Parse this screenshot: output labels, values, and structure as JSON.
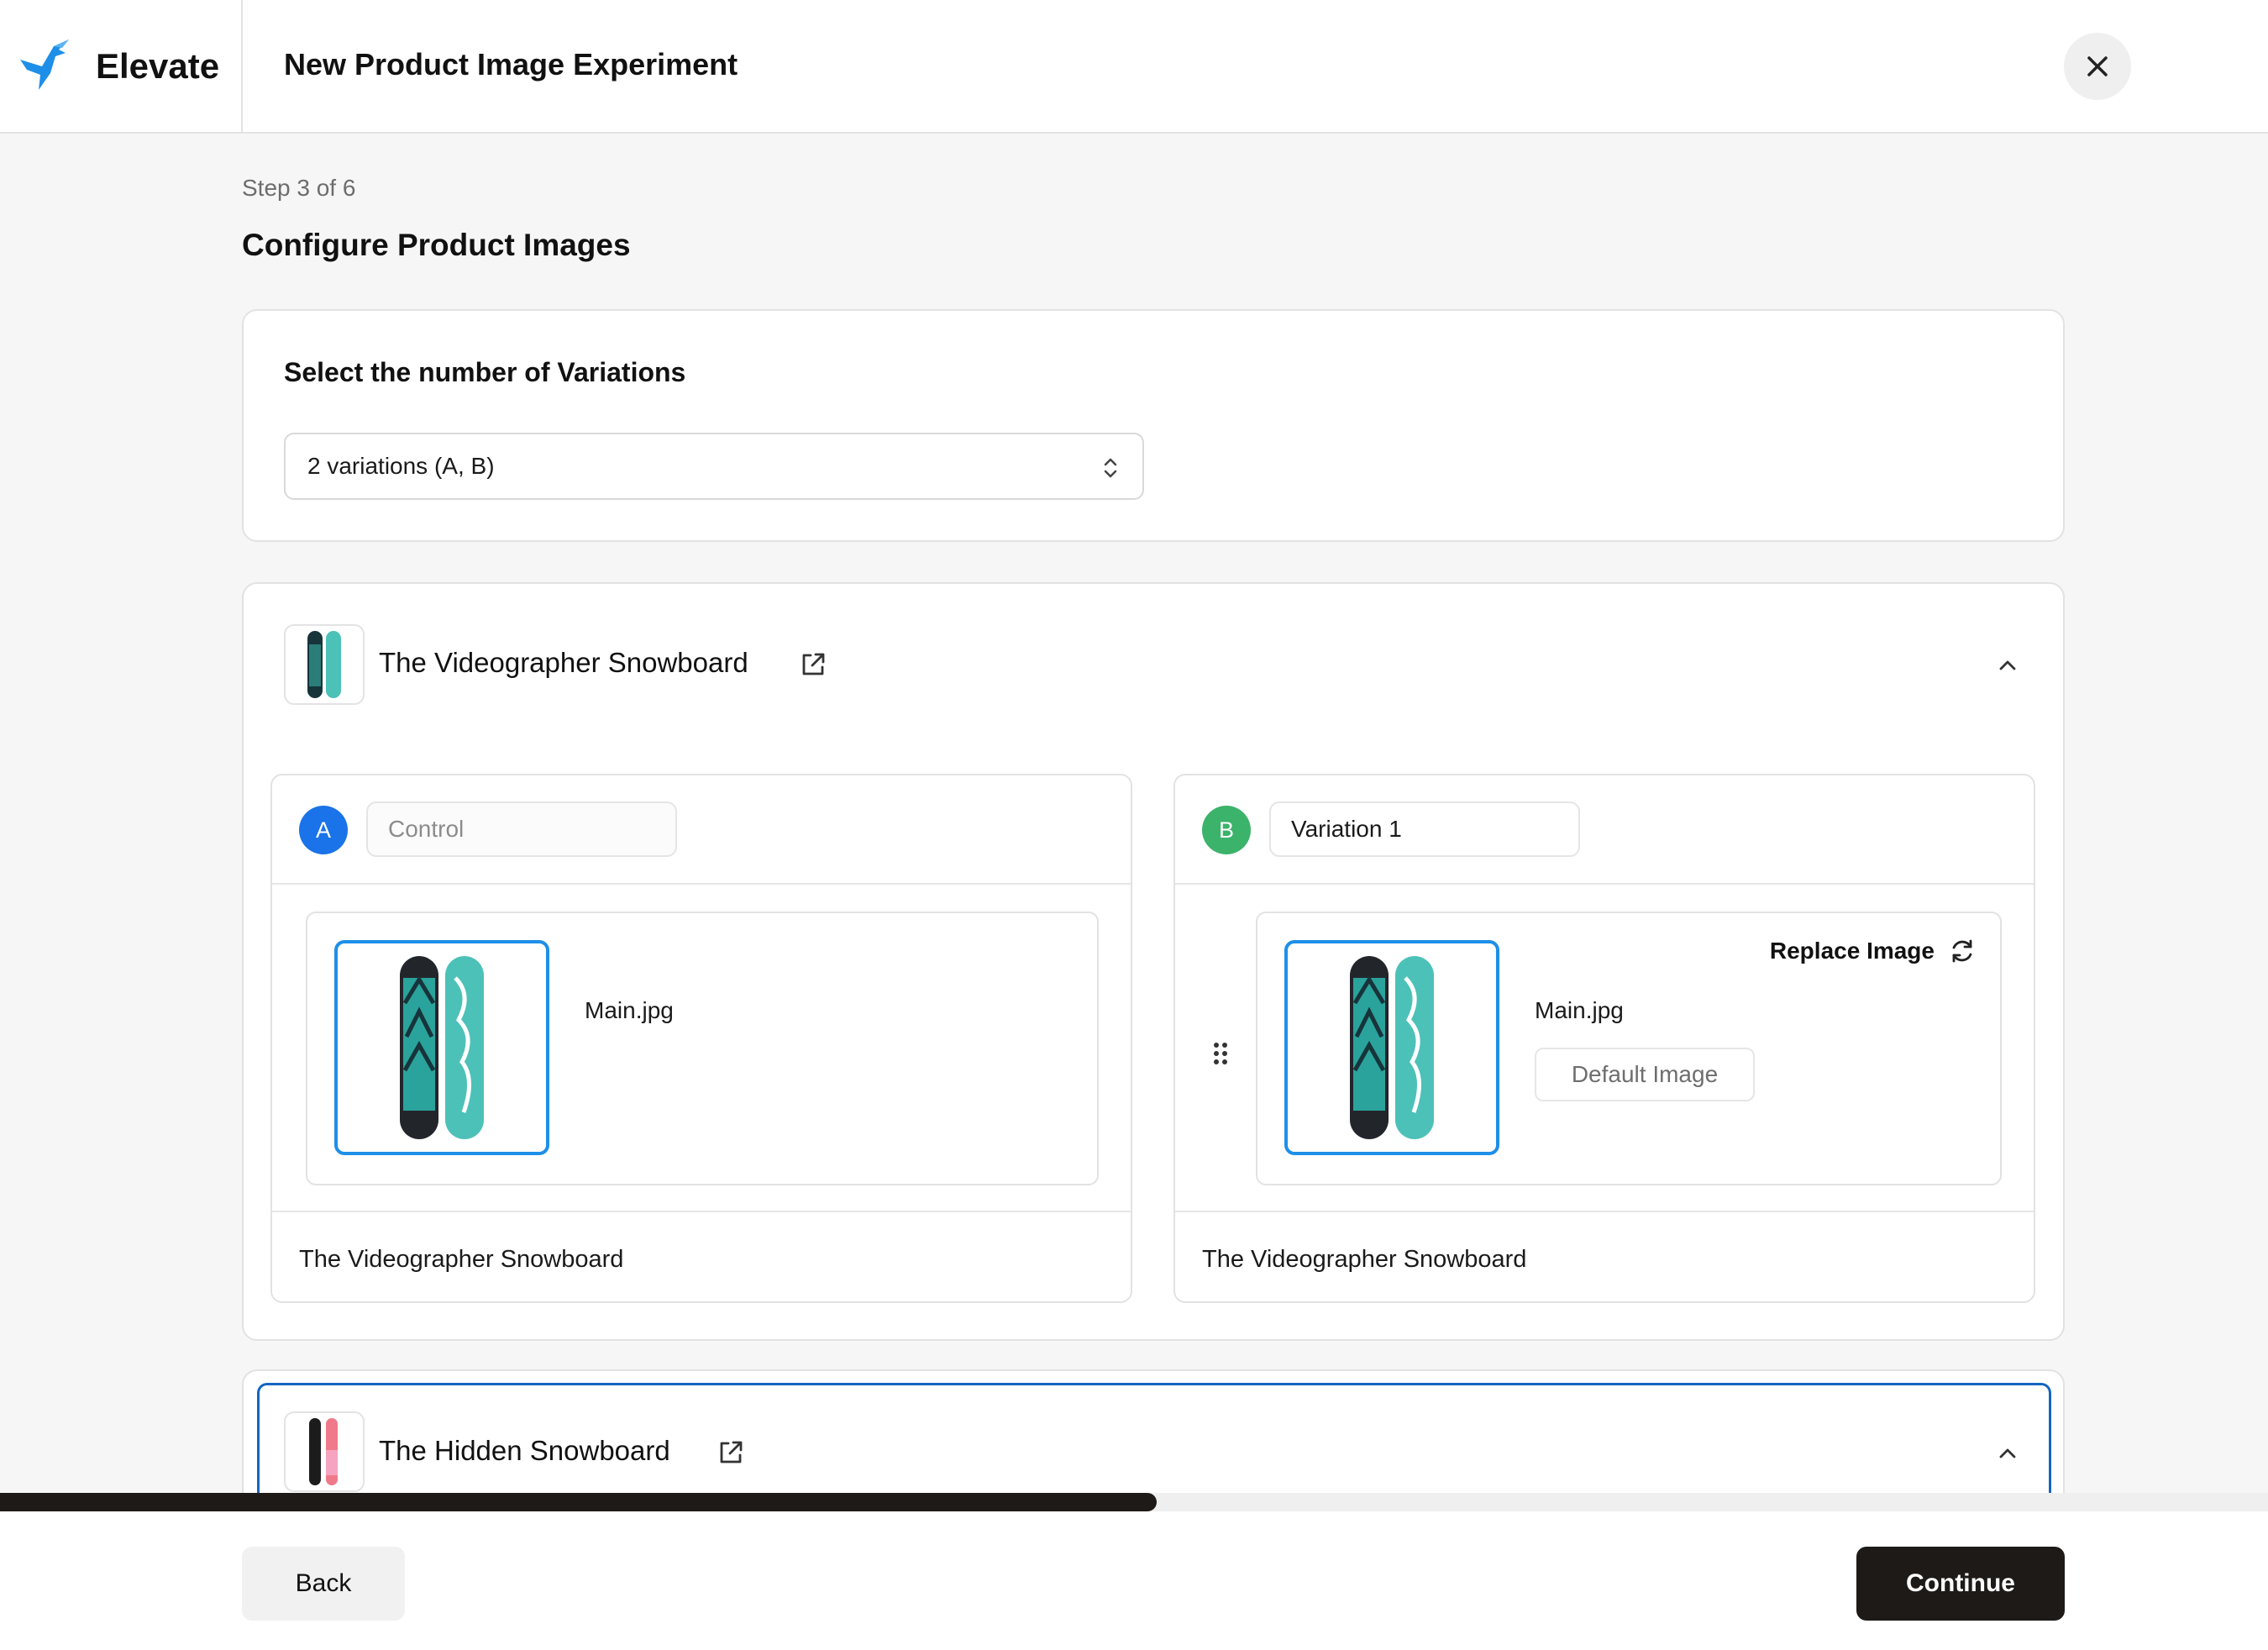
{
  "app": {
    "name": "Elevate",
    "logo_icon": "hummingbird-logo-icon"
  },
  "header": {
    "title": "New Product Image Experiment",
    "close_icon": "close-icon"
  },
  "step": {
    "label": "Step 3 of 6",
    "title": "Configure Product Images"
  },
  "variations": {
    "label": "Select the number of Variations",
    "selected": "2 variations (A, B)"
  },
  "products": [
    {
      "title": "The Videographer Snowboard",
      "expanded": true,
      "variations": [
        {
          "badge": "A",
          "name_placeholder": "Control",
          "name_value": "",
          "image_file": "Main.jpg",
          "product_name": "The Videographer Snowboard"
        },
        {
          "badge": "B",
          "name_placeholder": "",
          "name_value": "Variation 1",
          "image_file": "Main.jpg",
          "default_label": "Default Image",
          "replace_label": "Replace Image",
          "product_name": "The Videographer Snowboard"
        }
      ]
    },
    {
      "title": "The Hidden Snowboard",
      "expanded": true
    }
  ],
  "progress": {
    "fraction": 0.51
  },
  "footer": {
    "back_label": "Back",
    "continue_label": "Continue"
  },
  "colors": {
    "accent_blue": "#1a73e8",
    "accent_green": "#3bb36b",
    "selection_border": "#1e8fe8",
    "primary_button": "#1d1a18",
    "snowboard_teal": "#4cc1b8"
  }
}
